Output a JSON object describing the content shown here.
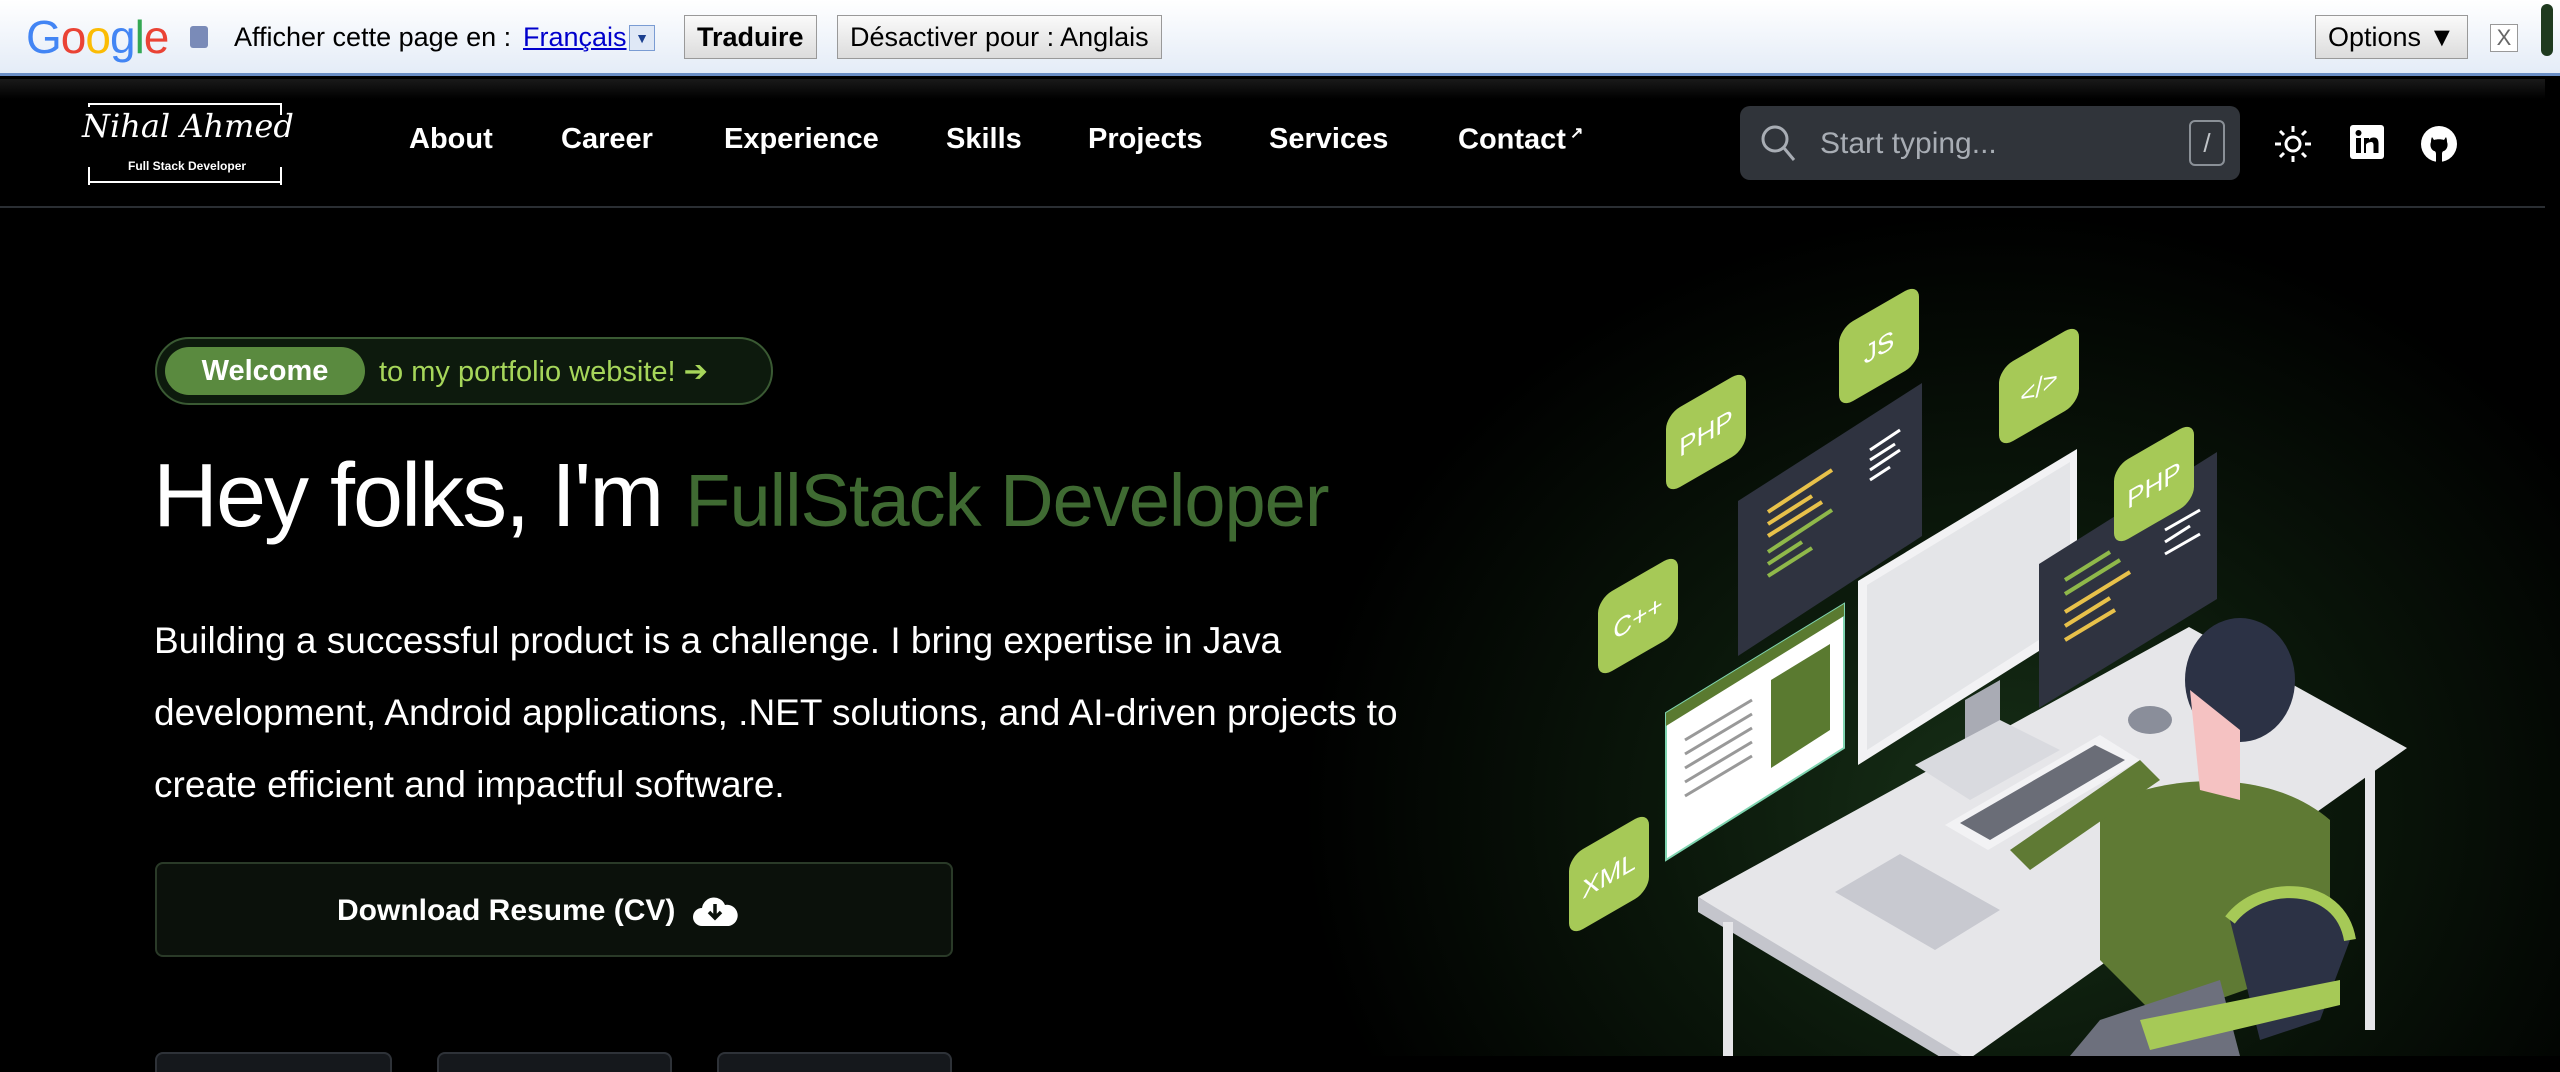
{
  "translate_bar": {
    "logo_text": "Google",
    "prompt": "Afficher cette page en :",
    "language": "Français",
    "translate_button": "Traduire",
    "disable_button": "Désactiver pour : Anglais",
    "options_button": "Options ▼",
    "close": "X"
  },
  "nav": {
    "logo_name": "Nihal Ahmed",
    "logo_subtitle": "Full Stack Developer",
    "items": [
      "About",
      "Career",
      "Experience",
      "Skills",
      "Projects",
      "Services",
      "Contact"
    ],
    "contact_external": "↗",
    "search_placeholder": "Start typing...",
    "search_shortcut": "/"
  },
  "hero": {
    "badge": "Welcome",
    "badge_text": "to my portfolio website! ➔",
    "heading": "Hey folks, I'm",
    "heading_accent": "FullStack Developer",
    "description": "Building a successful product is a challenge. I bring expertise in Java development, Android applications, .NET solutions, and AI-driven projects to create efficient and impactful software.",
    "download_button": "Download Resume (CV)"
  },
  "illustration": {
    "tiles": [
      "JS",
      "PHP",
      "</>",
      "PHP",
      "C++",
      "XML"
    ]
  },
  "colors": {
    "accent": "#a6c957",
    "accent_dark": "#5a8a3f",
    "background": "#000000"
  }
}
